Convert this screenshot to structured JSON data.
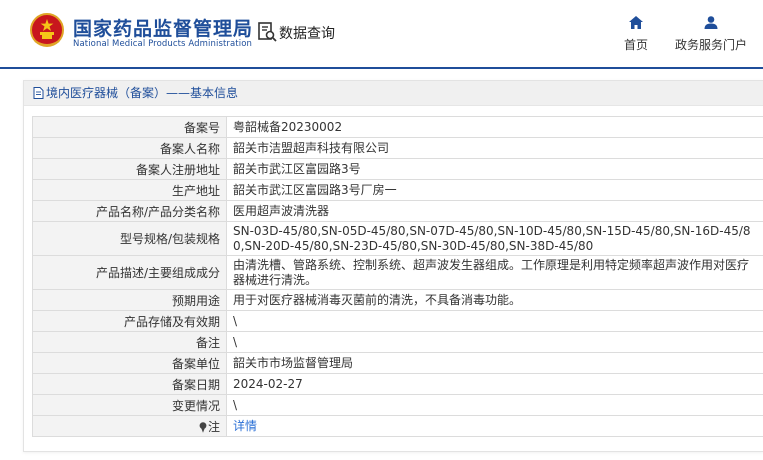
{
  "header": {
    "site_name_cn": "国家药品监督管理局",
    "site_name_en": "National Medical Products Administration",
    "data_query_label": "数据查询",
    "nav": {
      "home_label": "首页",
      "portal_label": "政务服务门户"
    }
  },
  "colors": {
    "brand": "#1f4e9a",
    "link": "#2a6fd6",
    "key_cell_bg": "#f3f3f3",
    "title_bar_bg": "#f0f0f0"
  },
  "icons": {
    "emblem": "national-emblem-icon",
    "query": "data-query-icon",
    "home": "home-icon",
    "portal": "user-icon",
    "title": "document-icon",
    "note": "pin-icon"
  },
  "panel": {
    "title": "境内医疗器械（备案）——基本信息"
  },
  "record": {
    "rows": [
      {
        "key": "备案号",
        "value": "粤韶械备20230002"
      },
      {
        "key": "备案人名称",
        "value": "韶关市洁盟超声科技有限公司"
      },
      {
        "key": "备案人注册地址",
        "value": "韶关市武江区富园路3号"
      },
      {
        "key": "生产地址",
        "value": "韶关市武江区富园路3号厂房一"
      },
      {
        "key": "产品名称/产品分类名称",
        "value": "医用超声波清洗器"
      },
      {
        "key": "型号规格/包装规格",
        "value": "SN-03D-45/80,SN-05D-45/80,SN-07D-45/80,SN-10D-45/80,SN-15D-45/80,SN-16D-45/80,SN-20D-45/80,SN-23D-45/80,SN-30D-45/80,SN-38D-45/80"
      },
      {
        "key": "产品描述/主要组成成分",
        "value": "由清洗槽、管路系统、控制系统、超声波发生器组成。工作原理是利用特定频率超声波作用对医疗器械进行清洗。"
      },
      {
        "key": "预期用途",
        "value": "用于对医疗器械消毒灭菌前的清洗，不具备消毒功能。"
      },
      {
        "key": "产品存储及有效期",
        "value": "\\"
      },
      {
        "key": "备注",
        "value": "\\"
      },
      {
        "key": "备案单位",
        "value": "韶关市市场监督管理局"
      },
      {
        "key": "备案日期",
        "value": "2024-02-27"
      },
      {
        "key": "变更情况",
        "value": "\\"
      }
    ],
    "note": {
      "key": "注",
      "value": "详情"
    }
  }
}
